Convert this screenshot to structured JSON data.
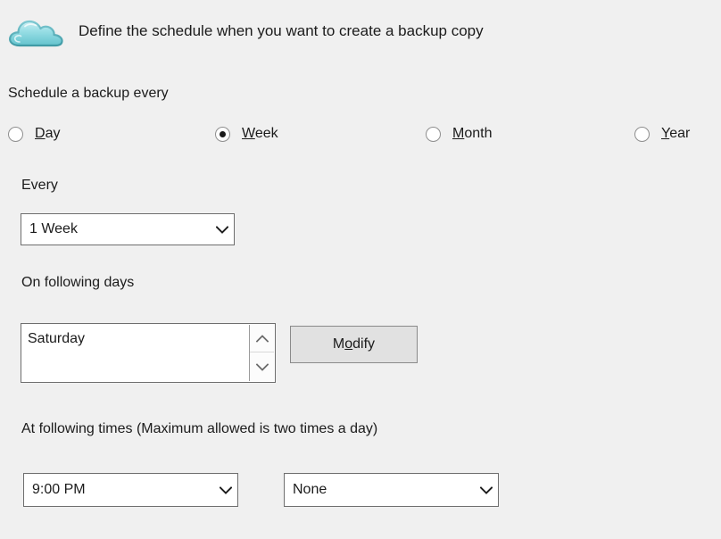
{
  "header": {
    "icon": "cloud-icon",
    "title": "Define the schedule when you want to create a backup copy"
  },
  "schedule": {
    "group_label": "Schedule a backup every",
    "frequency_options": [
      {
        "label": "Day",
        "accel": "D",
        "rest": "ay",
        "selected": false
      },
      {
        "label": "Week",
        "accel": "W",
        "rest": "eek",
        "selected": true
      },
      {
        "label": "Month",
        "accel": "M",
        "rest": "onth",
        "selected": false
      },
      {
        "label": "Year",
        "accel": "Y",
        "rest": "ear",
        "selected": false
      }
    ],
    "every": {
      "label": "Every",
      "value": "1 Week"
    },
    "following_days": {
      "label": "On following days",
      "items": [
        "Saturday"
      ],
      "spinner_up_icon": "chevron-up-icon",
      "spinner_down_icon": "chevron-down-icon",
      "modify_button": {
        "label": "Modify",
        "accel_prefix": "M",
        "accel": "o",
        "accel_suffix": "dify"
      }
    },
    "following_times": {
      "label": "At following times (Maximum allowed is two times a day)",
      "time_one": "9:00 PM",
      "time_two": "None"
    }
  },
  "icons": {
    "combo_arrow": "chevron-down-icon"
  },
  "colors": {
    "background": "#f0f0f0",
    "text": "#1b1b1b",
    "field_border": "#6e6e6e",
    "field_background": "#ffffff",
    "button_background": "#e1e1e1",
    "cloud_icon": "#7fd0d8"
  }
}
